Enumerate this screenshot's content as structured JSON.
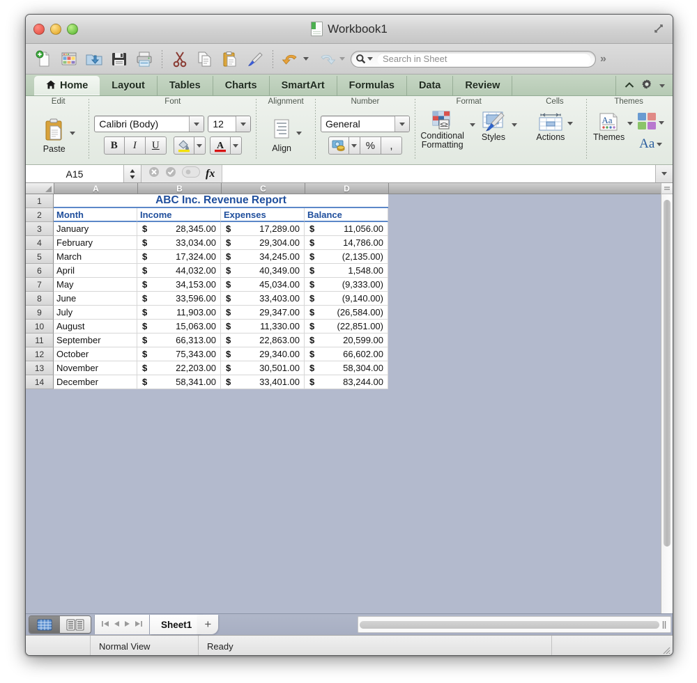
{
  "window": {
    "title": "Workbook1",
    "doc_icon": "spreadsheet-document-icon",
    "controls": {
      "close": "close",
      "minimize": "minimize",
      "zoom": "zoom",
      "fullscreen": "expand"
    }
  },
  "toolbar": {
    "items": [
      {
        "name": "new-icon",
        "label": "New"
      },
      {
        "name": "gallery-icon",
        "label": "Elements Gallery"
      },
      {
        "name": "open-icon",
        "label": "Open"
      },
      {
        "name": "save-icon",
        "label": "Save"
      },
      {
        "name": "print-icon",
        "label": "Print"
      },
      {
        "name": "cut-icon",
        "label": "Cut"
      },
      {
        "name": "copy-icon",
        "label": "Copy"
      },
      {
        "name": "paste-icon",
        "label": "Paste"
      },
      {
        "name": "format-painter-icon",
        "label": "Format"
      },
      {
        "name": "undo-icon",
        "label": "Undo"
      },
      {
        "name": "redo-icon",
        "label": "Redo"
      }
    ],
    "search": {
      "placeholder": "Search in Sheet",
      "value": "",
      "icon": "search-icon"
    },
    "overflow": "»"
  },
  "ribbon_tabs": [
    {
      "label": "Home",
      "active": true,
      "icon": "home-icon"
    },
    {
      "label": "Layout",
      "active": false
    },
    {
      "label": "Tables",
      "active": false
    },
    {
      "label": "Charts",
      "active": false
    },
    {
      "label": "SmartArt",
      "active": false
    },
    {
      "label": "Formulas",
      "active": false
    },
    {
      "label": "Data",
      "active": false
    },
    {
      "label": "Review",
      "active": false
    }
  ],
  "ribbon_right": {
    "collapse": "^",
    "gear": "gear-icon",
    "gear_arrow": "▾"
  },
  "ribbon_groups": {
    "edit": {
      "label": "Edit",
      "paste_label": "Paste"
    },
    "font": {
      "label": "Font",
      "font_name": "Calibri (Body)",
      "font_size": "12",
      "bold": "B",
      "italic": "I",
      "underline": "U",
      "fill_color": "fill-color-icon",
      "font_color": "A"
    },
    "alignment": {
      "label": "Alignment",
      "align_label": "Align"
    },
    "number": {
      "label": "Number",
      "format": "General",
      "currency": "currency-icon",
      "percent": "%",
      "comma": ","
    },
    "format": {
      "label": "Format",
      "conditional_line1": "Conditional",
      "conditional_line2": "Formatting",
      "styles_label": "Styles"
    },
    "cells": {
      "label": "Cells",
      "actions_label": "Actions"
    },
    "themes": {
      "label": "Themes",
      "themes_label": "Themes",
      "aa": "Aa"
    }
  },
  "formula_bar": {
    "name_box": "A15",
    "cancel": "cancel-icon",
    "accept": "accept-icon",
    "function_wizard": "fx",
    "formula_value": ""
  },
  "grid": {
    "column_headers": [
      "A",
      "B",
      "C",
      "D"
    ],
    "row_numbers": [
      "1",
      "2",
      "3",
      "4",
      "5",
      "6",
      "7",
      "8",
      "9",
      "10",
      "11",
      "12",
      "13",
      "14"
    ],
    "title_row": {
      "row": "1",
      "text": "ABC Inc. Revenue Report"
    },
    "header_row": {
      "row": "2",
      "cells": [
        "Month",
        "Income",
        "Expenses",
        "Balance"
      ]
    },
    "currency_symbol": "$",
    "data_rows": [
      {
        "row": "3",
        "month": "January",
        "income": "28,345.00",
        "expenses": "17,289.00",
        "balance": "11,056.00"
      },
      {
        "row": "4",
        "month": "February",
        "income": "33,034.00",
        "expenses": "29,304.00",
        "balance": "14,786.00"
      },
      {
        "row": "5",
        "month": "March",
        "income": "17,324.00",
        "expenses": "34,245.00",
        "balance": "(2,135.00)"
      },
      {
        "row": "6",
        "month": "April",
        "income": "44,032.00",
        "expenses": "40,349.00",
        "balance": "1,548.00"
      },
      {
        "row": "7",
        "month": "May",
        "income": "34,153.00",
        "expenses": "45,034.00",
        "balance": "(9,333.00)"
      },
      {
        "row": "8",
        "month": "June",
        "income": "33,596.00",
        "expenses": "33,403.00",
        "balance": "(9,140.00)"
      },
      {
        "row": "9",
        "month": "July",
        "income": "11,903.00",
        "expenses": "29,347.00",
        "balance": "(26,584.00)"
      },
      {
        "row": "10",
        "month": "August",
        "income": "15,063.00",
        "expenses": "11,330.00",
        "balance": "(22,851.00)"
      },
      {
        "row": "11",
        "month": "September",
        "income": "66,313.00",
        "expenses": "22,863.00",
        "balance": "20,599.00"
      },
      {
        "row": "12",
        "month": "October",
        "income": "75,343.00",
        "expenses": "29,340.00",
        "balance": "66,602.00"
      },
      {
        "row": "13",
        "month": "November",
        "income": "22,203.00",
        "expenses": "30,501.00",
        "balance": "58,304.00"
      },
      {
        "row": "14",
        "month": "December",
        "income": "58,341.00",
        "expenses": "33,401.00",
        "balance": "83,244.00"
      }
    ]
  },
  "sheet_bar": {
    "view_normal": "normal-view-icon",
    "view_layout": "page-layout-view-icon",
    "nav_first": "⏮",
    "nav_prev": "◀",
    "nav_next": "▶",
    "nav_last": "⏭",
    "tabs": [
      "Sheet1"
    ],
    "add_sheet": "+"
  },
  "status_bar": {
    "view_mode": "Normal View",
    "status": "Ready"
  },
  "colors": {
    "header_text_blue": "#1f4e9c",
    "header_rule_blue": "#5b87c8",
    "sheet_background": "#b3bacd",
    "ribbon_green": "#b6cab4"
  }
}
